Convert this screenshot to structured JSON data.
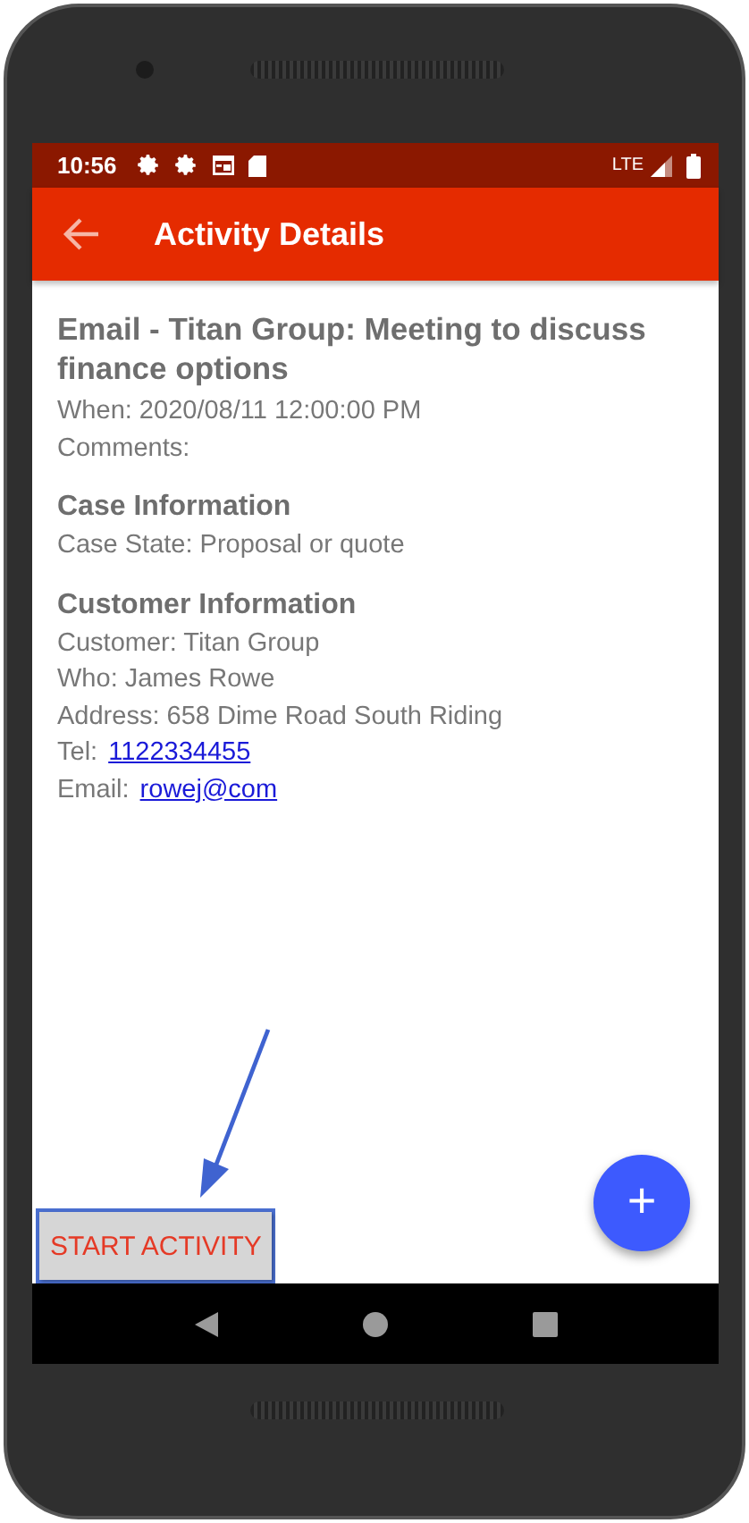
{
  "status_bar": {
    "time": "10:56",
    "network": "LTE"
  },
  "app_bar": {
    "title": "Activity Details"
  },
  "activity": {
    "title": "Email - Titan Group: Meeting to discuss finance options",
    "fields": [
      {
        "kind": "text",
        "label": "When: 2020/08/11 12:00:00 PM"
      },
      {
        "kind": "text",
        "label": "Comments:"
      }
    ]
  },
  "sections": [
    {
      "heading": "Case Information",
      "fields": [
        {
          "kind": "text",
          "label": "Case State: Proposal or quote"
        }
      ]
    },
    {
      "heading": "Customer Information",
      "fields": [
        {
          "kind": "text",
          "label": "Customer: Titan Group"
        },
        {
          "kind": "text",
          "label": "Who: James Rowe"
        },
        {
          "kind": "text",
          "label": "Address: 658 Dime Road South Riding"
        },
        {
          "kind": "link",
          "label": "Tel:",
          "value": "1122334455"
        },
        {
          "kind": "link",
          "label": "Email:",
          "value": "rowej@com"
        }
      ]
    }
  ],
  "start_button": {
    "label": "START ACTIVITY",
    "highlighted": true
  },
  "fab": {
    "label": "+"
  }
}
